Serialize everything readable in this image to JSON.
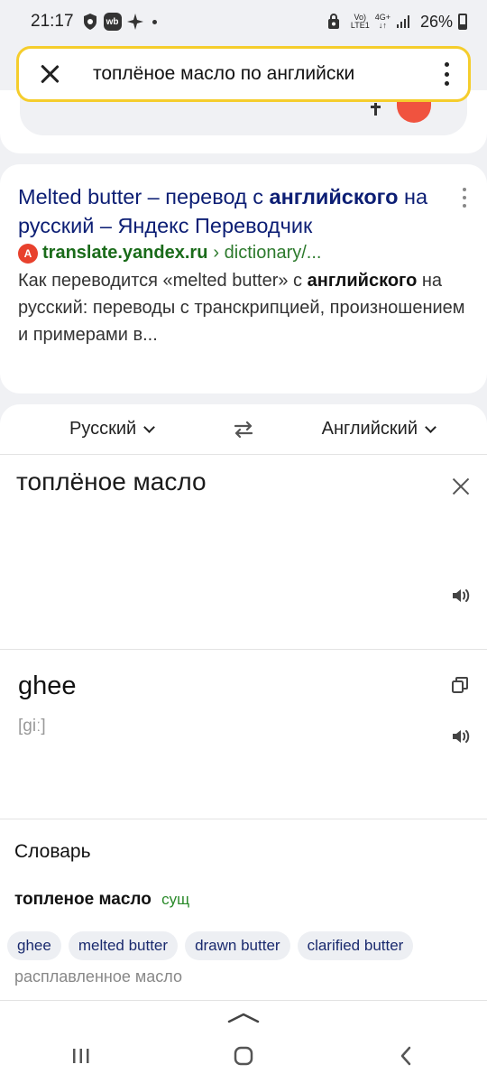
{
  "status_bar": {
    "time": "21:17",
    "badge_text": "wb",
    "network_top": "Vo)",
    "network_bottom": "LTE1",
    "network_gen": "4G+",
    "battery": "26%"
  },
  "search": {
    "query": "топлёное масло по английски"
  },
  "result": {
    "title_part1": "Melted butter – перевод с ",
    "title_bold1": "английского",
    "title_part2": " на русский – Яндекс Переводчик",
    "favicon_text": "A",
    "domain": "translate.yandex.ru",
    "path": "› dictionary/...",
    "snippet_part1": "Как переводится «melted butter» с ",
    "snippet_bold": "английского",
    "snippet_part2": " на русский: переводы с транскрипцией, произношением и примерами в..."
  },
  "translator": {
    "source_lang": "Русский",
    "target_lang": "Английский",
    "source_text": "топлёное масло",
    "translation": "ghee",
    "transcription": "[giː]"
  },
  "dictionary": {
    "heading": "Словарь",
    "word": "топленое масло",
    "pos": "сущ",
    "chips": [
      "ghee",
      "melted butter",
      "drawn butter",
      "clarified butter"
    ],
    "note": "расплавленное масло"
  },
  "colors": {
    "search_border": "#f5cd2c",
    "link_title": "#0c1e74",
    "url_green": "#1a6b1a",
    "favicon": "#e8412d",
    "pos_green": "#2a8a2a"
  }
}
